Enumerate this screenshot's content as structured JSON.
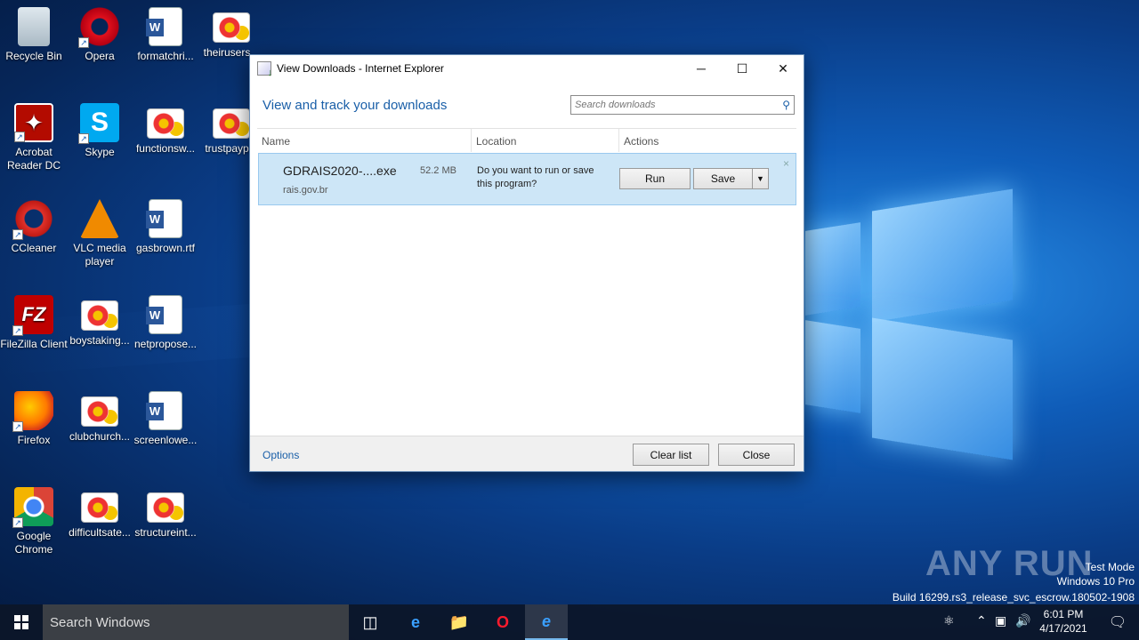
{
  "desktop": {
    "icons": [
      {
        "label": "Recycle Bin"
      },
      {
        "label": "Opera"
      },
      {
        "label": "formatchri..."
      },
      {
        "label": "theirusers..."
      },
      {
        "label": "Acrobat Reader DC"
      },
      {
        "label": "Skype"
      },
      {
        "label": "functionsw..."
      },
      {
        "label": "trustpayp..."
      },
      {
        "label": "CCleaner"
      },
      {
        "label": "VLC media player"
      },
      {
        "label": "gasbrown.rtf"
      },
      {
        "label": "FileZilla Client"
      },
      {
        "label": "boystaking..."
      },
      {
        "label": "netpropose..."
      },
      {
        "label": "Firefox"
      },
      {
        "label": "clubchurch..."
      },
      {
        "label": "screenlowe..."
      },
      {
        "label": "Google Chrome"
      },
      {
        "label": "difficultsate..."
      },
      {
        "label": "structureint..."
      }
    ]
  },
  "window": {
    "title": "View Downloads - Internet Explorer",
    "minimize": "─",
    "maximize": "☐",
    "close": "✕",
    "heading": "View and track your downloads",
    "search_placeholder": "Search downloads",
    "columns": {
      "name": "Name",
      "location": "Location",
      "actions": "Actions"
    },
    "download": {
      "filename": "GDRAIS2020-....exe",
      "size": "52.2 MB",
      "source": "rais.gov.br",
      "question": "Do you want to run or save this program?",
      "run_label": "Run",
      "save_label": "Save",
      "dismiss": "×"
    },
    "footer": {
      "options": "Options",
      "clear_list": "Clear list",
      "close": "Close"
    }
  },
  "watermark": {
    "brand": "ANY RUN",
    "mode": "Test Mode",
    "edition": "Windows 10 Pro",
    "build": "Build 16299.rs3_release_svc_escrow.180502-1908"
  },
  "taskbar": {
    "search_placeholder": "Search Windows",
    "time": "6:01 PM",
    "date": "4/17/2021"
  },
  "colors": {
    "accent": "#1a5fa8",
    "selection": "#cde6f7",
    "taskbar": "#0c1628"
  }
}
